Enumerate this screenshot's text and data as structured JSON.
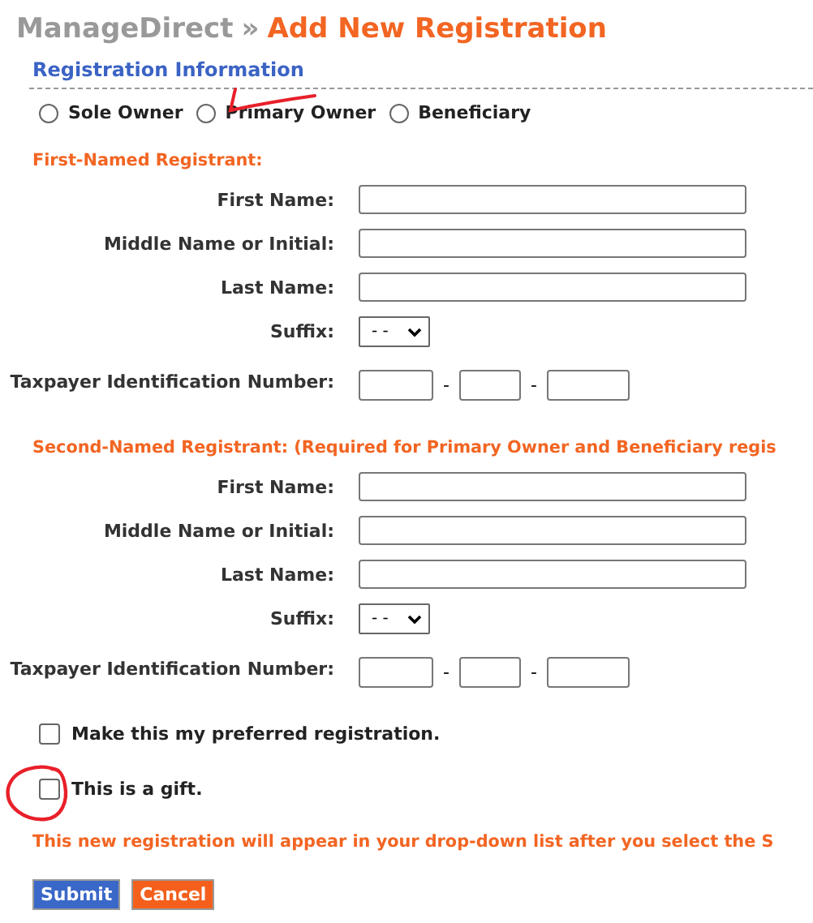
{
  "header": {
    "breadcrumb": "ManageDirect",
    "separator": "»",
    "title": "Add New Registration"
  },
  "section_title": "Registration Information",
  "ownership_options": [
    {
      "label": "Sole Owner",
      "selected": false
    },
    {
      "label": "Primary Owner",
      "selected": false
    },
    {
      "label": "Beneficiary",
      "selected": false
    }
  ],
  "registrants": [
    {
      "heading": "First-Named Registrant:",
      "fields": [
        {
          "kind": "text",
          "label": "First Name:"
        },
        {
          "kind": "text",
          "label": "Middle Name or Initial:"
        },
        {
          "kind": "text",
          "label": "Last Name:"
        },
        {
          "kind": "select",
          "label": "Suffix:",
          "value": "- -"
        },
        {
          "kind": "tin",
          "label": "Taxpayer Identification Number:",
          "separators": [
            "-",
            "-"
          ]
        }
      ]
    },
    {
      "heading": "Second-Named Registrant: (Required for Primary Owner and Beneficiary regis",
      "fields": [
        {
          "kind": "text",
          "label": "First Name:"
        },
        {
          "kind": "text",
          "label": "Middle Name or Initial:"
        },
        {
          "kind": "text",
          "label": "Last Name:"
        },
        {
          "kind": "select",
          "label": "Suffix:",
          "value": "- -"
        },
        {
          "kind": "tin",
          "label": "Taxpayer Identification Number:",
          "separators": [
            "-",
            "-"
          ]
        }
      ]
    }
  ],
  "options": [
    {
      "label": "Make this my preferred registration.",
      "checked": false
    },
    {
      "label": "This is a gift.",
      "checked": false
    }
  ],
  "notice": "This new registration will appear in your drop-down list after you select the S",
  "buttons": [
    {
      "label": "Submit",
      "kind": "primary"
    },
    {
      "label": "Cancel",
      "kind": "secondary"
    }
  ]
}
